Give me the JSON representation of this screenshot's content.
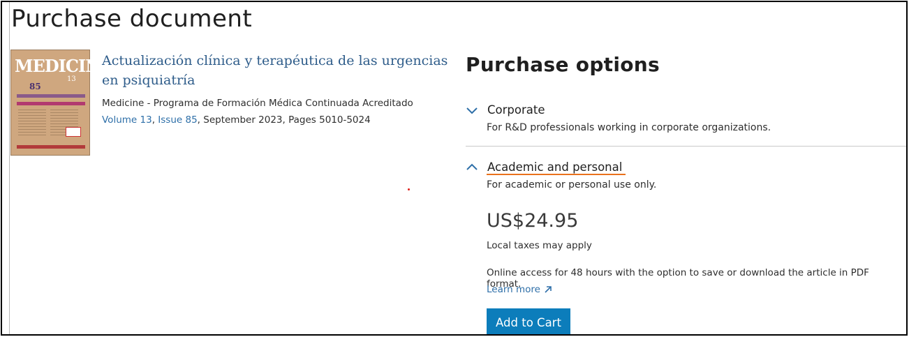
{
  "page": {
    "title": "Purchase document"
  },
  "article": {
    "cover_masthead": "MEDICINE",
    "cover_number": "85",
    "cover_volume": "13",
    "title": "Actualización clínica y terapéutica de las urgencias en psiquiatría",
    "journal": "Medicine - Programa de Formación Médica Continuada Acreditado",
    "volume_link": "Volume 13",
    "issue_link": "Issue 85",
    "date_pages": ", September 2023, Pages 5010-5024",
    "separator": ", "
  },
  "purchase": {
    "title": "Purchase options",
    "options": [
      {
        "label": "Corporate",
        "description": "For R&D professionals working in corporate organizations.",
        "expanded": false,
        "icon": "chevron-down-icon"
      },
      {
        "label": "Academic and personal",
        "description": "For academic or personal use only.",
        "expanded": true,
        "icon": "chevron-up-icon"
      }
    ],
    "price": "US$24.95",
    "taxes_note": "Local taxes may apply",
    "access_note": "Online access for 48 hours with the option to save or download the article in PDF format.",
    "learn_more": "Learn more",
    "add_to_cart": "Add to Cart"
  },
  "colors": {
    "link": "#2e6fa8",
    "button": "#0c7dbb",
    "accent_underline": "#e9711c",
    "chevron": "#2e6fa8"
  }
}
